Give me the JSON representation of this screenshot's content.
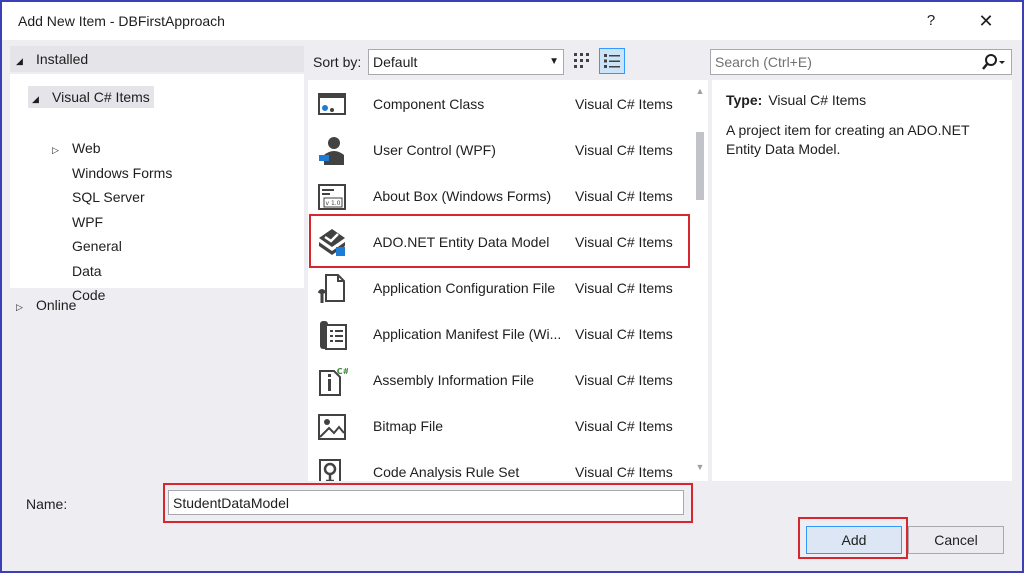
{
  "window": {
    "title": "Add New Item - DBFirstApproach",
    "help_label": "?",
    "close_label": "✕"
  },
  "tree": {
    "installed_label": "Installed",
    "online_label": "Online",
    "items": [
      {
        "label": "Visual C# Items",
        "selected": true
      },
      {
        "label": "Web"
      },
      {
        "label": "Windows Forms"
      },
      {
        "label": "SQL Server"
      },
      {
        "label": "WPF"
      },
      {
        "label": "General"
      },
      {
        "label": "Data"
      },
      {
        "label": "Code"
      }
    ]
  },
  "toolbar": {
    "sort_label": "Sort by:",
    "sort_value": "Default"
  },
  "search": {
    "placeholder": "Search (Ctrl+E)"
  },
  "templates": [
    {
      "name": "Component Class",
      "category": "Visual C# Items",
      "icon": "component-class-icon"
    },
    {
      "name": "User Control (WPF)",
      "category": "Visual C# Items",
      "icon": "user-control-icon"
    },
    {
      "name": "About Box (Windows Forms)",
      "category": "Visual C# Items",
      "icon": "about-box-icon"
    },
    {
      "name": "ADO.NET Entity Data Model",
      "category": "Visual C# Items",
      "icon": "entity-data-model-icon",
      "selected": true
    },
    {
      "name": "Application Configuration File",
      "category": "Visual C# Items",
      "icon": "config-file-icon"
    },
    {
      "name": "Application Manifest File (Wi...",
      "category": "Visual C# Items",
      "icon": "manifest-file-icon"
    },
    {
      "name": "Assembly Information File",
      "category": "Visual C# Items",
      "icon": "assembly-info-icon"
    },
    {
      "name": "Bitmap File",
      "category": "Visual C# Items",
      "icon": "bitmap-file-icon"
    },
    {
      "name": "Code Analysis Rule Set",
      "category": "Visual C# Items",
      "icon": "rule-set-icon"
    }
  ],
  "details": {
    "type_label": "Type:",
    "type_value": "Visual C# Items",
    "description": "A project item for creating an ADO.NET Entity Data Model."
  },
  "bottom": {
    "name_label": "Name:",
    "name_value": "StudentDataModel",
    "add_label": "Add",
    "cancel_label": "Cancel"
  },
  "colors": {
    "accent_border": "#3d3fb8",
    "highlight_red": "#d7262f",
    "focus_blue": "#3399ff"
  }
}
